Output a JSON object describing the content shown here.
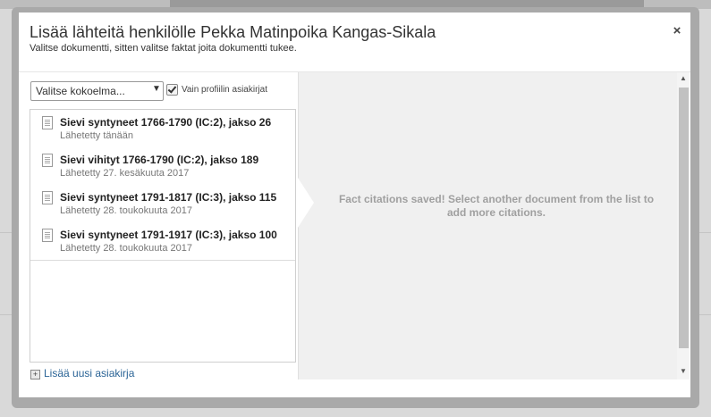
{
  "dialog": {
    "title": "Lisää lähteitä henkilölle Pekka Matinpoika Kangas-Sikala",
    "subtitle": "Valitse dokumentti, sitten valitse faktat joita dokumentti tukee.",
    "close_label": "×"
  },
  "filters": {
    "collection_select": "Valitse kokoelma...",
    "collection_arrow": "▼",
    "profile_only_label": "Vain profiilin asiakirjat",
    "profile_only_checked": true
  },
  "documents": [
    {
      "title": "Sievi syntyneet 1766-1790 (IC:2), jakso 26",
      "date": "Lähetetty tänään"
    },
    {
      "title": "Sievi vihityt 1766-1790 (IC:2), jakso 189",
      "date": "Lähetetty 27. kesäkuuta 2017"
    },
    {
      "title": "Sievi syntyneet 1791-1817 (IC:3), jakso 115",
      "date": "Lähetetty 28. toukokuuta 2017"
    },
    {
      "title": "Sievi syntyneet 1791-1917 (IC:3), jakso 100",
      "date": "Lähetetty 28. toukokuuta 2017"
    }
  ],
  "add_document": {
    "icon": "+",
    "label": "Lisää uusi asiakirja"
  },
  "panel": {
    "message": "Fact citations saved! Select another document from the list to add more citations."
  },
  "scrollbar": {
    "up": "▲",
    "down": "▼"
  }
}
